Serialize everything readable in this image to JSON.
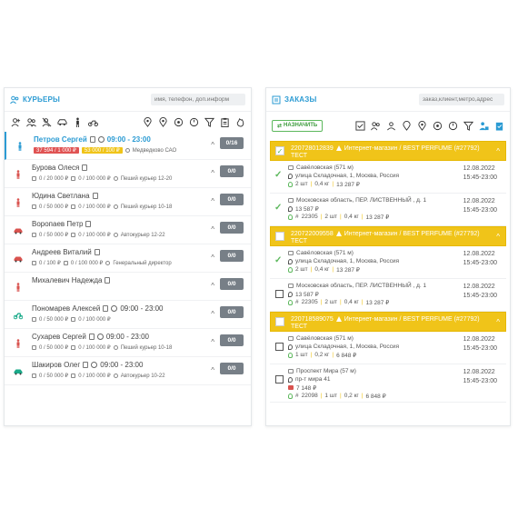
{
  "couriers_panel": {
    "title": "КУРЬЕРЫ",
    "search_placeholder": "имя, телефон, доп.информ"
  },
  "orders_panel": {
    "title": "ЗАКАЗЫ",
    "search_placeholder": "заказ,клиент,метро,адрес",
    "assign_label": "НАЗНАЧИТЬ"
  },
  "couriers": [
    {
      "name": "Петров Сергей",
      "time": "09:00 - 23:00",
      "money_red": "37 594 / 1 000 ₽",
      "money_yellow": "53 000 / 100 ₽",
      "info": "Медведково САО",
      "count": "0/16",
      "icon_color": "#2b9bd3",
      "icon": "person-icon"
    },
    {
      "name": "Бурова Олеся",
      "time": "",
      "money": "0 / 20 000 ₽",
      "money2": "0 / 100 000 ₽",
      "info": "Пеший курьер 12-20",
      "count": "0/0",
      "icon_color": "#d9534f",
      "icon": "person-icon"
    },
    {
      "name": "Юдина Светлана",
      "time": "",
      "money": "0 / 50 000 ₽",
      "money2": "0 / 100 000 ₽",
      "info": "Пеший курьер 10-18",
      "count": "0/0",
      "icon_color": "#d9534f",
      "icon": "person-icon"
    },
    {
      "name": "Воропаев Петр",
      "time": "",
      "money": "0 / 50 000 ₽",
      "money2": "0 / 100 000 ₽",
      "info": "Автокурьер 12-22",
      "count": "0/0",
      "icon_color": "#d9534f",
      "icon": "car-icon"
    },
    {
      "name": "Андреев Виталий",
      "time": "",
      "money": "0 / 100 ₽",
      "money2": "0 / 100 000 ₽",
      "info": "Генеральный директор",
      "count": "0/0",
      "icon_color": "#d9534f",
      "icon": "car-icon"
    },
    {
      "name": "Михалевич Надежда",
      "time": "",
      "money": "",
      "money2": "",
      "info": "",
      "count": "0/0",
      "icon_color": "#d9534f",
      "icon": "person-icon"
    },
    {
      "name": "Пономарев Алексей",
      "time": "09:00 - 23:00",
      "money": "0 / 50 000 ₽",
      "money2": "0 / 100 000 ₽",
      "info": "",
      "count": "0/0",
      "icon_color": "#1aaa8a",
      "icon": "motorbike-icon"
    },
    {
      "name": "Сухарев Сергей",
      "time": "09:00 - 23:00",
      "money": "0 / 50 000 ₽",
      "money2": "0 / 100 000 ₽",
      "info": "Пеший курьер 10-18",
      "count": "0/0",
      "icon_color": "#d9534f",
      "icon": "person-icon"
    },
    {
      "name": "Шакиров Олег",
      "time": "09:00 - 23:00",
      "money": "0 / 50 000 ₽",
      "money2": "0 / 100 000 ₽",
      "info": "Автокурьер 10-22",
      "count": "0/0",
      "icon_color": "#1aaa8a",
      "icon": "car-icon"
    }
  ],
  "order_groups": [
    {
      "id": "220728012839",
      "shop": "Интернет-магазин / BEST PERFUME (#27792)",
      "tag": "ТЕСТ",
      "orders": [
        {
          "checked": true,
          "metro": "Савёловская (571 м)",
          "address": "улица Складочная, 1, Москва, Россия",
          "detail": "2 шт",
          "weight": "0,4 кг",
          "price": "13 287 ₽",
          "order_no": "",
          "date": "12.08.2022",
          "time": "15:45-23:00"
        },
        {
          "checked": true,
          "metro": "Московская область, ПЕР. ЛИСТВЕННЫЙ , д. 1",
          "address": "13 587 ₽",
          "detail": "22305",
          "weight": "2 шт",
          "weight2": "0,4 кг",
          "price": "13 287 ₽",
          "date": "12.08.2022",
          "time": "15:45-23:00"
        }
      ]
    },
    {
      "id": "220722009558",
      "shop": "Интернет-магазин / BEST PERFUME (#27792)",
      "tag": "ТЕСТ",
      "orders": [
        {
          "checked": true,
          "metro": "Савёловская (571 м)",
          "address": "улица Складочная, 1, Москва, Россия",
          "detail": "2 шт",
          "weight": "0,4 кг",
          "price": "13 287 ₽",
          "date": "12.08.2022",
          "time": "15:45-23:00"
        },
        {
          "checked": false,
          "metro": "Московская область, ПЕР. ЛИСТВЕННЫЙ , д. 1",
          "address": "13 587 ₽",
          "detail": "22305",
          "weight": "2 шт",
          "weight2": "0,4 кг",
          "price": "13 287 ₽",
          "date": "12.08.2022",
          "time": "15:45-23:00"
        }
      ]
    },
    {
      "id": "220718589075",
      "shop": "Интернет-магазин / BEST PERFUME (#27792)",
      "tag": "ТЕСТ",
      "orders": [
        {
          "checked": false,
          "metro": "Савёловская (571 м)",
          "address": "улица Складочная, 1, Москва, Россия",
          "detail": "1 шт",
          "weight": "0,2 кг",
          "price": "6 848 ₽",
          "date": "12.08.2022",
          "time": "15:45-23:00"
        },
        {
          "checked": false,
          "metro": "Проспект Мира (57 м)",
          "address": "пр-т мира 41",
          "address2": "7 148 ₽",
          "detail": "22098",
          "weight": "1 шт",
          "weight2": "0,2 кг",
          "price": "6 848 ₽",
          "date": "12.08.2022",
          "time": "15:45-23:00"
        }
      ]
    }
  ],
  "colors": {
    "accent": "#2b9bd3",
    "group": "#f0c419",
    "count_badge": "#777f87",
    "assign": "#5cb85c"
  }
}
